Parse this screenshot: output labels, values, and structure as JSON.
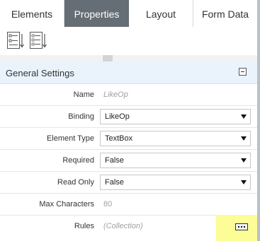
{
  "tabs": [
    {
      "label": "Elements",
      "active": false
    },
    {
      "label": "Properties",
      "active": true
    },
    {
      "label": "Layout",
      "active": false
    },
    {
      "label": "Form Data",
      "active": false
    }
  ],
  "toolbar": {
    "categorized_icon": "categorized-view-icon",
    "alphabetical_icon": "alphabetical-sort-icon"
  },
  "section": {
    "title": "General Settings",
    "collapse_icon": "collapse-minus-icon"
  },
  "properties": {
    "name": {
      "label": "Name",
      "value": "LikeOp"
    },
    "binding": {
      "label": "Binding",
      "value": "LikeOp"
    },
    "element_type": {
      "label": "Element Type",
      "value": "TextBox"
    },
    "required": {
      "label": "Required",
      "value": "False"
    },
    "read_only": {
      "label": "Read Only",
      "value": "False"
    },
    "max_characters": {
      "label": "Max Characters",
      "value": "80"
    },
    "rules": {
      "label": "Rules",
      "value": "(Collection)"
    }
  },
  "colors": {
    "active_tab": "#666e75",
    "section_bg": "#eaf3fc",
    "highlight": "#fdfd97"
  }
}
